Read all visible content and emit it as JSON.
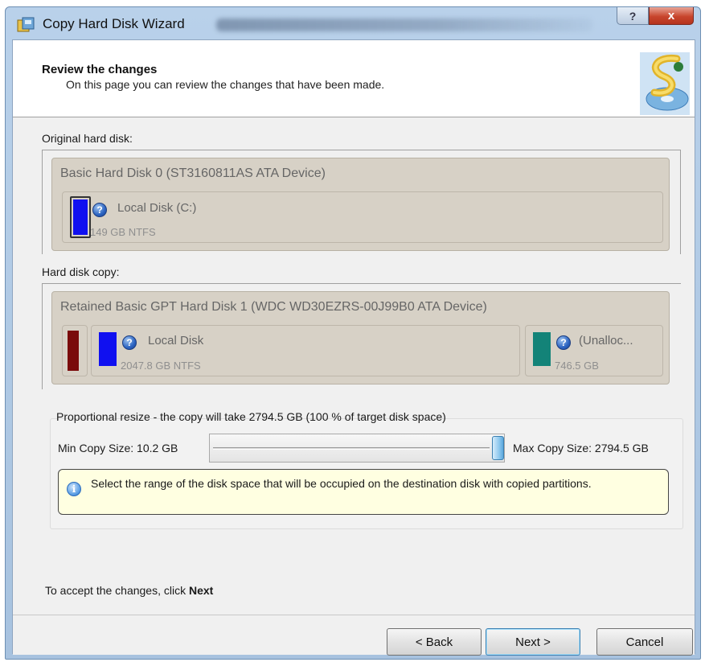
{
  "window": {
    "title": "Copy Hard Disk Wizard",
    "help_label": "?",
    "close_label": "x"
  },
  "header": {
    "title": "Review the changes",
    "subtitle": "On this page you can review the changes that have been made."
  },
  "original": {
    "section_label": "Original hard disk:",
    "disk_title": "Basic Hard Disk 0 (ST3160811AS ATA Device)",
    "partitions": [
      {
        "name": "Local Disk (C:)",
        "size": "149 GB NTFS",
        "color": "#1010f0"
      }
    ]
  },
  "copy": {
    "section_label": "Hard disk copy:",
    "disk_title": "Retained Basic GPT Hard Disk 1 (WDC WD30EZRS-00J99B0 ATA Device)",
    "partitions": [
      {
        "name": "",
        "size": "",
        "color": "#7a0b0b"
      },
      {
        "name": "Local Disk",
        "size": "2047.8 GB NTFS",
        "color": "#1010f0"
      },
      {
        "name": "(Unalloc...",
        "size": "746.5 GB",
        "color": "#138378"
      }
    ]
  },
  "resize": {
    "description": "Proportional resize - the copy will take 2794.5 GB (100 % of target disk space)",
    "min_label": "Min Copy Size:  10.2 GB",
    "max_label": "Max Copy Size:  2794.5 GB",
    "slider_fraction": 1.0,
    "info": "Select the range of the disk space that will be occupied on the destination disk with copied partitions."
  },
  "footer": {
    "accept_prefix": "To accept the changes, click ",
    "accept_action": "Next"
  },
  "buttons": {
    "back": "< Back",
    "next": "Next >",
    "cancel": "Cancel"
  }
}
